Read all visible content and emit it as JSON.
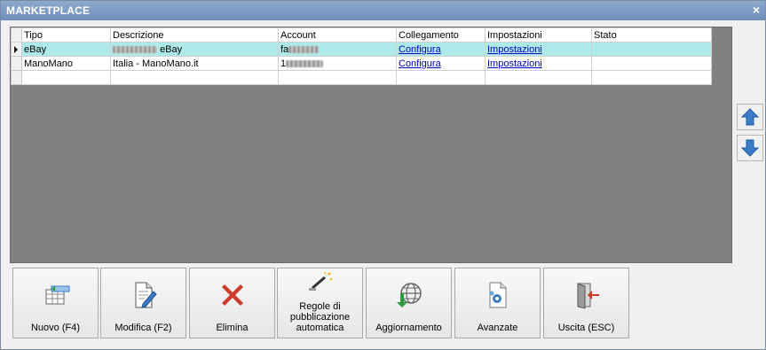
{
  "window": {
    "title": "MARKETPLACE",
    "close_glyph": "×"
  },
  "grid": {
    "columns": [
      "Tipo",
      "Descrizione",
      "Account",
      "Collegamento",
      "Impostazioni",
      "Stato"
    ],
    "rows": [
      {
        "tipo": "eBay",
        "descrizione": "eBay",
        "account": "fa",
        "collegamento": "Configura",
        "impostazioni": "Impostazioni",
        "stato": "",
        "selected": true
      },
      {
        "tipo": "ManoMano",
        "descrizione": "Italia - ManoMano.it",
        "account": "1",
        "collegamento": "Configura",
        "impostazioni": "Impostazioni",
        "stato": "",
        "selected": false
      }
    ]
  },
  "side_buttons": {
    "up_icon": "arrow-up-icon",
    "down_icon": "arrow-down-icon",
    "color": "#3b7cc6"
  },
  "toolbar": {
    "nuovo": "Nuovo (F4)",
    "modifica": "Modifica (F2)",
    "elimina": "Elimina",
    "regole_l1": "Regole di",
    "regole_l2": "pubblicazione",
    "regole_l3": "automatica",
    "aggiornamento": "Aggiornamento",
    "avanzate": "Avanzate",
    "uscita": "Uscita (ESC)"
  },
  "colors": {
    "selected_row": "#aeeaea",
    "grid_bg": "#808080",
    "title_bar": "#7f9bc6",
    "delete_red": "#d03a2a"
  }
}
